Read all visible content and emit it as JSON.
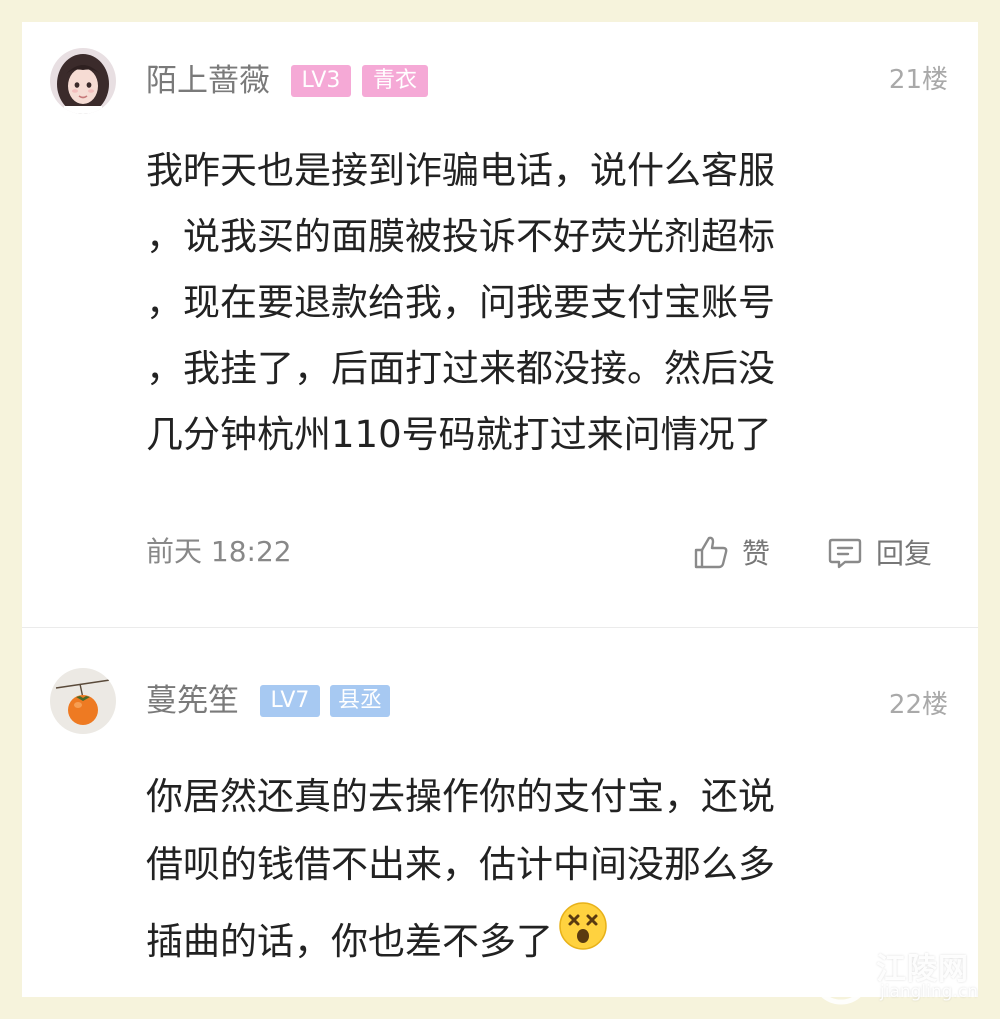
{
  "comments": [
    {
      "username": "陌上蔷薇",
      "level": "LV3",
      "title_badge": "青衣",
      "floor": "21楼",
      "body_lines": [
        "我昨天也是接到诈骗电话，说什么客服",
        "，说我买的面膜被投诉不好荧光剂超标",
        "，现在要退款给我，问我要支付宝账号",
        "，我挂了，后面打过来都没接。然后没",
        "几分钟杭州110号码就打过来问情况了"
      ],
      "time": "前天 18:22",
      "like_label": "赞",
      "reply_label": "回复",
      "avatar_icon": "girl-avatar-icon",
      "badge_color": "#f5a9d6"
    },
    {
      "username": "蔓筅笙",
      "level": "LV7",
      "title_badge": "县丞",
      "floor": "22楼",
      "body_lines": [
        "你居然还真的去操作你的支付宝，还说",
        "借呗的钱借不出来，估计中间没那么多",
        "插曲的话，你也差不多了"
      ],
      "emoji": "dizzy-face-emoji",
      "avatar_icon": "persimmon-avatar-icon",
      "badge_color": "#a7c9f2"
    }
  ],
  "watermark": {
    "name": "江陵网",
    "url": "jiangling.cn"
  },
  "colors": {
    "page_background": "#f6f3dc",
    "card_background": "#ffffff",
    "body_text": "#222222",
    "muted_text": "#888888"
  }
}
